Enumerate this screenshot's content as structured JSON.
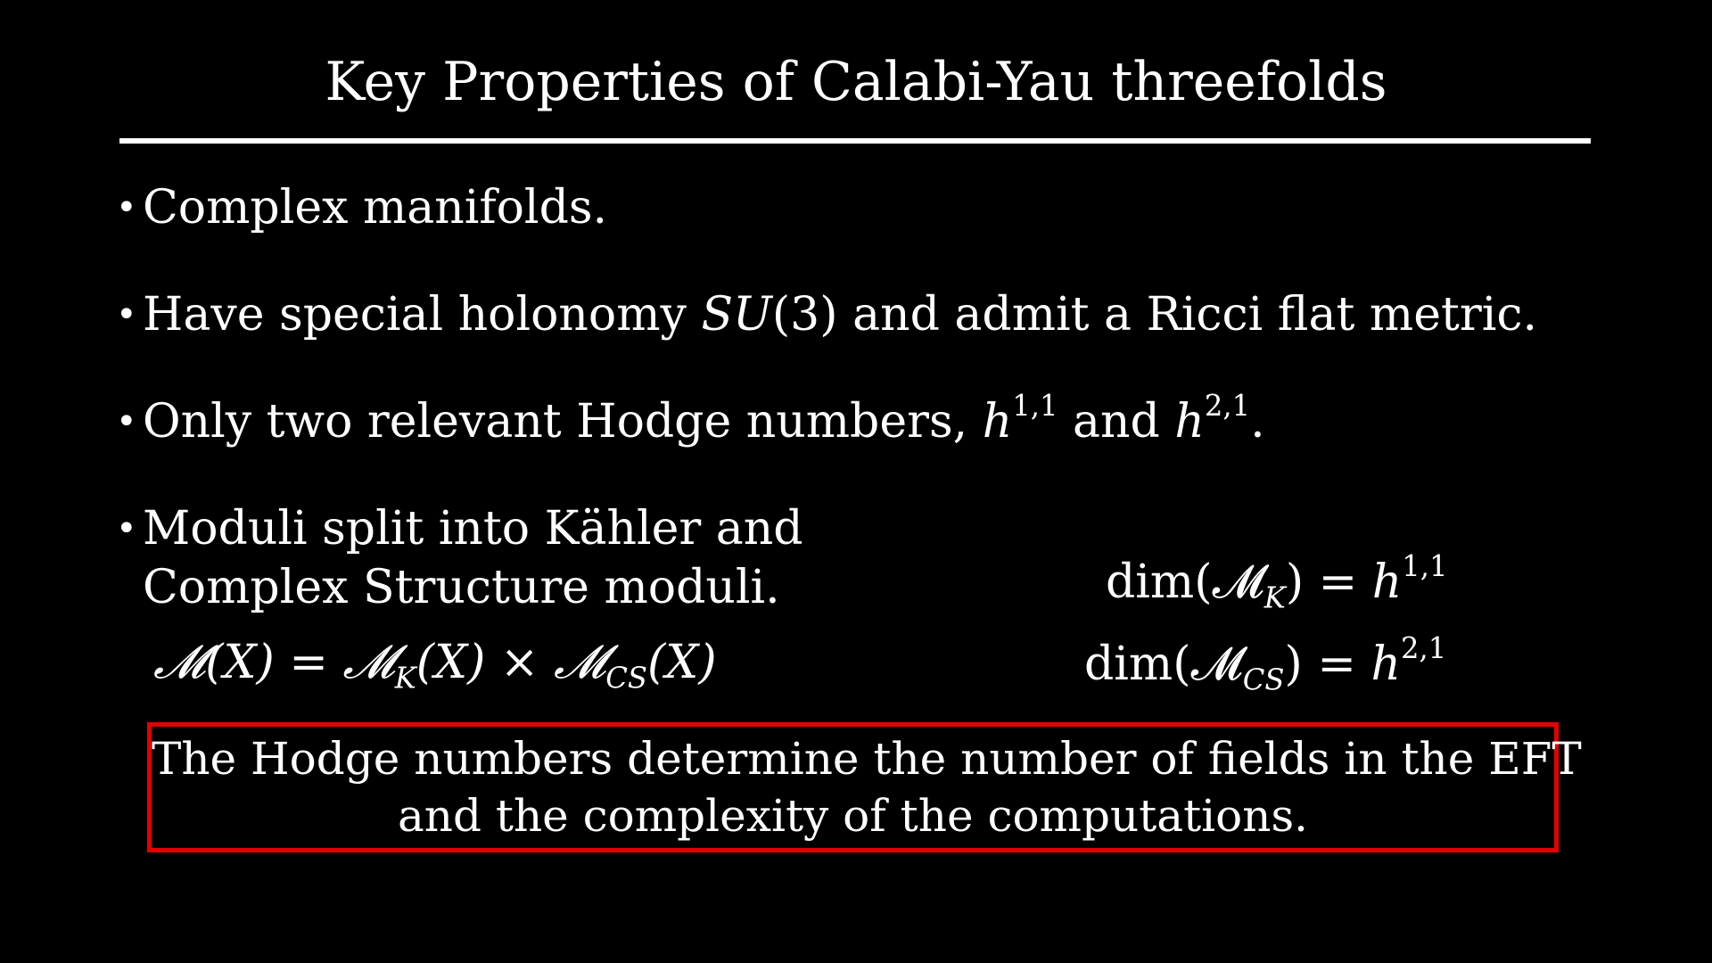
{
  "slide": {
    "title": "Key Properties of Calabi-Yau threefolds",
    "bullets": [
      {
        "text": "Complex manifolds."
      },
      {
        "before": "Have special holonomy ",
        "math": "SU",
        "math_paren": "(3)",
        "after": " and admit a Ricci flat metric."
      },
      {
        "before": "Only two relevant Hodge numbers, ",
        "h11_sym": "h",
        "h11_sup": "1,1",
        "mid": " and ",
        "h21_sym": "h",
        "h21_sup": "2,1",
        "after": "."
      },
      {
        "line1": "Moduli split into Kähler and",
        "line2": "Complex Structure moduli."
      }
    ],
    "bullet_symbol": "•",
    "equations": {
      "moduli_product": {
        "lhs": "𝓜(X) = 𝓜",
        "k": "K",
        "mid": "(X) × 𝓜",
        "cs": "CS",
        "end": "(X)"
      },
      "dim_k": {
        "pre": "dim(𝓜",
        "sub": "K",
        "post": ") = ",
        "h": "h",
        "sup": "1,1"
      },
      "dim_cs": {
        "pre": "dim(𝓜",
        "sub": "CS",
        "post": ") = ",
        "h": "h",
        "sup": "2,1"
      }
    },
    "callout": {
      "line1": "The Hodge numbers determine the number of fields in the EFT",
      "line2": "and the complexity of the computations.",
      "border_color": "#e50000"
    }
  }
}
